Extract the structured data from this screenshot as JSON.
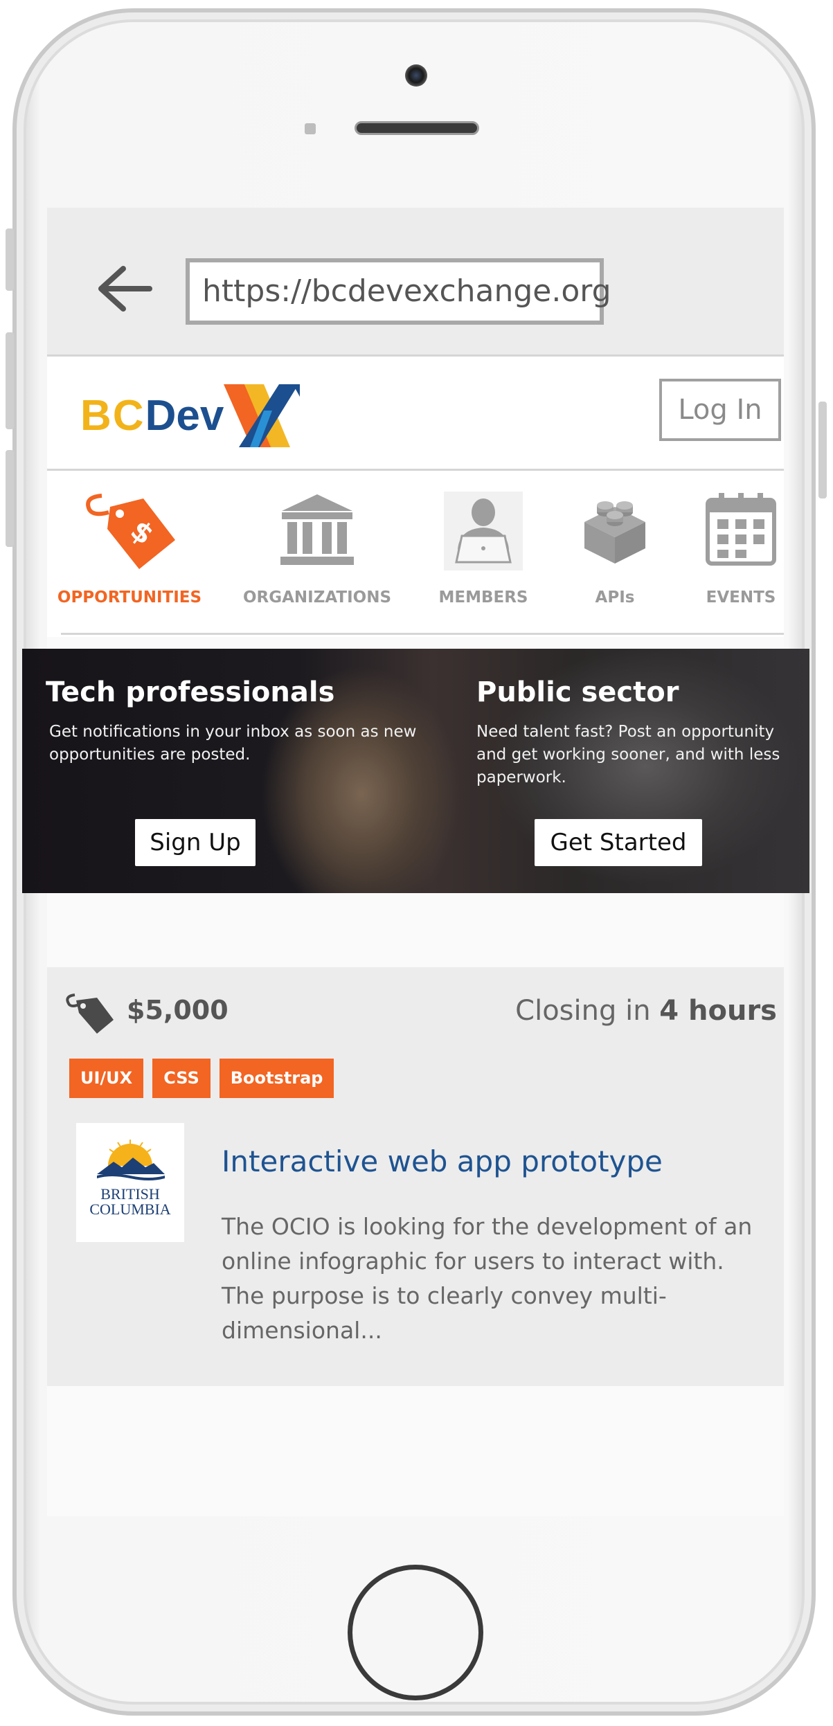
{
  "browser": {
    "url": "https://bcdevexchange.org"
  },
  "header": {
    "logo_part1": "BC",
    "logo_part2": "Dev",
    "login_label": "Log In"
  },
  "nav": {
    "items": [
      {
        "label": "OPPORTUNITIES",
        "icon": "price-tag-icon"
      },
      {
        "label": "ORGANIZATIONS",
        "icon": "building-icon"
      },
      {
        "label": "MEMBERS",
        "icon": "member-icon"
      },
      {
        "label": "APIs",
        "icon": "lego-brick-icon"
      },
      {
        "label": "EVENTS",
        "icon": "calendar-icon"
      }
    ]
  },
  "hero": {
    "left": {
      "title": "Tech professionals",
      "text": "Get notifications in your inbox as soon as new opportunities are posted.",
      "button": "Sign Up"
    },
    "right": {
      "title": "Public sector",
      "text": "Need talent fast? Post an opportunity and get working sooner, and with less paperwork.",
      "button": "Get Started"
    }
  },
  "opportunity": {
    "price": "$5,000",
    "closing_prefix": "Closing in",
    "closing_value": "4 hours",
    "tags": [
      "UI/UX",
      "CSS",
      "Bootstrap"
    ],
    "org_line1": "BRITISH",
    "org_line2": "COLUMBIA",
    "title": "Interactive web app prototype",
    "description": "The OCIO is looking for the development of an online infographic for users to interact with. The purpose is to clearly convey multi-dimensional..."
  },
  "colors": {
    "accent": "#f26522",
    "link": "#1e5391",
    "logo_yellow": "#f2b31a",
    "logo_blue": "#1c4f8f"
  }
}
